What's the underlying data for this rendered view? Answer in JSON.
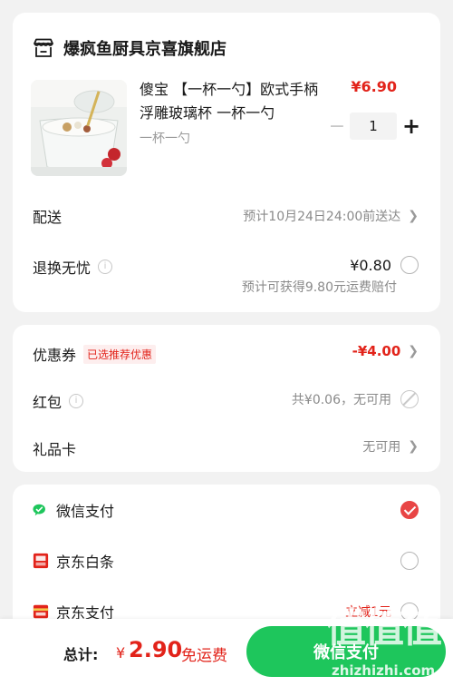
{
  "shop": {
    "name": "爆疯鱼厨具京喜旗舰店"
  },
  "product": {
    "title": "傻宝 【一杯一勺】欧式手柄浮雕玻璃杯 一杯一勺",
    "spec": "一杯一勺",
    "price": "¥6.90",
    "quantity": "1",
    "minus": "−",
    "plus": "+"
  },
  "delivery": {
    "label": "配送",
    "value": "预计10月24日24:00前送达"
  },
  "return_insurance": {
    "label": "退换无忧",
    "price": "¥0.80",
    "note": "预计可获得9.80元运费赔付"
  },
  "coupon": {
    "label": "优惠券",
    "tag": "已选推荐优惠",
    "value": "-¥4.00"
  },
  "red_packet": {
    "label": "红包",
    "value": "共¥0.06，无可用"
  },
  "gift_card": {
    "label": "礼品卡",
    "value": "无可用"
  },
  "payment": {
    "methods": [
      {
        "label": "微信支付",
        "selected": true
      },
      {
        "label": "京东白条",
        "selected": false
      },
      {
        "label": "京东支付",
        "promo": "立减1元",
        "selected": false
      }
    ]
  },
  "bottom": {
    "total_label": "总计:",
    "currency": "¥",
    "amount": "2.90",
    "free_shipping": "免运费",
    "pay_button": "微信支付"
  },
  "watermark": {
    "text": "值值值",
    "url": "zhizhizhi.com"
  },
  "colors": {
    "accent_red": "#e2231a",
    "wechat_green": "#1ec65c",
    "background": "#f2f2f2"
  }
}
